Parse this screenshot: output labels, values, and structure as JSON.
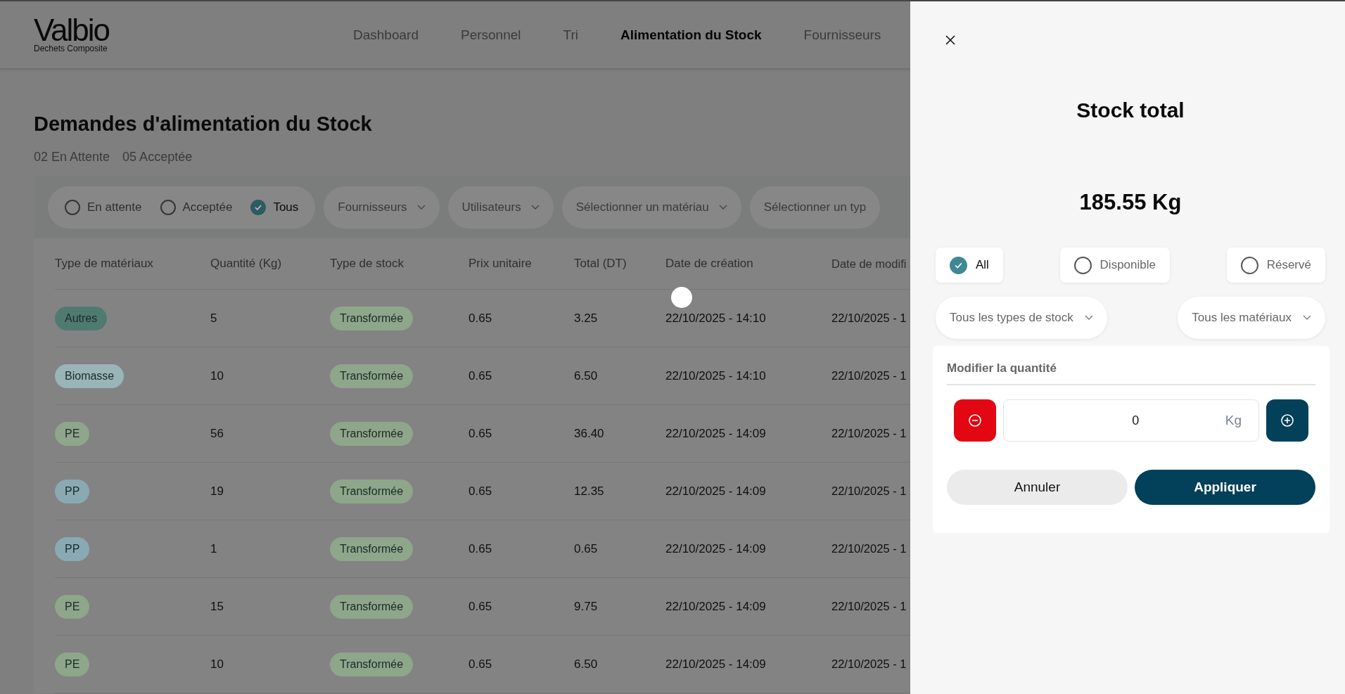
{
  "nav": {
    "logo": "Valbio",
    "logo_subtitle": "Dechets Composite",
    "items": [
      {
        "label": "Dashboard",
        "selected": false
      },
      {
        "label": "Personnel",
        "selected": false
      },
      {
        "label": "Tri",
        "selected": false
      },
      {
        "label": "Alimentation du Stock",
        "selected": true
      },
      {
        "label": "Fournisseurs",
        "selected": false
      }
    ]
  },
  "page": {
    "title": "Demandes d'alimentation du Stock",
    "counts": [
      "02 En Attente",
      "05 Acceptée"
    ]
  },
  "filters": {
    "status": [
      {
        "label": "En attente",
        "selected": false
      },
      {
        "label": "Acceptée",
        "selected": false
      },
      {
        "label": "Tous",
        "selected": true
      }
    ],
    "dropdowns": [
      {
        "label": "Fournisseurs",
        "chevron": true
      },
      {
        "label": "Utilisateurs",
        "chevron": true
      },
      {
        "label": "Sélectionner un matériau",
        "chevron": true
      },
      {
        "label": "Sélectionner un typ",
        "chevron": false
      }
    ]
  },
  "table": {
    "columns": [
      "Type de matériaux",
      "Quantité (Kg)",
      "Type de stock",
      "Prix unitaire",
      "Total (DT)",
      "Date de création",
      "Date de modifi"
    ],
    "rows": [
      {
        "material": "Autres",
        "color": "#4f7a70",
        "quantity": "5",
        "stock_type": "Transformée",
        "unit_price": "0.65",
        "total": "3.25",
        "created": "22/10/2025 - 14:10",
        "modified": "22/10/2025 - 1"
      },
      {
        "material": "Biomasse",
        "color": "#9ab4b8",
        "quantity": "10",
        "stock_type": "Transformée",
        "unit_price": "0.65",
        "total": "6.50",
        "created": "22/10/2025 - 14:10",
        "modified": "22/10/2025 - 1"
      },
      {
        "material": "PE",
        "color": "#8ea68a",
        "quantity": "56",
        "stock_type": "Transformée",
        "unit_price": "0.65",
        "total": "36.40",
        "created": "22/10/2025 - 14:09",
        "modified": "22/10/2025 - 1"
      },
      {
        "material": "PP",
        "color": "#89aab3",
        "quantity": "19",
        "stock_type": "Transformée",
        "unit_price": "0.65",
        "total": "12.35",
        "created": "22/10/2025 - 14:09",
        "modified": "22/10/2025 - 1"
      },
      {
        "material": "PP",
        "color": "#89aab3",
        "quantity": "1",
        "stock_type": "Transformée",
        "unit_price": "0.65",
        "total": "0.65",
        "created": "22/10/2025 - 14:09",
        "modified": "22/10/2025 - 1"
      },
      {
        "material": "PE",
        "color": "#8ea68a",
        "quantity": "15",
        "stock_type": "Transformée",
        "unit_price": "0.65",
        "total": "9.75",
        "created": "22/10/2025 - 14:09",
        "modified": "22/10/2025 - 1"
      },
      {
        "material": "PE",
        "color": "#8ea68a",
        "quantity": "10",
        "stock_type": "Transformée",
        "unit_price": "0.65",
        "total": "6.50",
        "created": "22/10/2025 - 14:09",
        "modified": "22/10/2025 - 1"
      }
    ]
  },
  "panel": {
    "title": "Stock total",
    "total": "185.55 Kg",
    "statuses": [
      {
        "label": "All",
        "selected": true
      },
      {
        "label": "Disponible",
        "selected": false
      },
      {
        "label": "Réservé",
        "selected": false
      }
    ],
    "dropdowns": [
      "Tous les types de stock",
      "Tous les matériaux"
    ],
    "quantity_card": {
      "title": "Modifier la quantité",
      "value": "0",
      "unit": "Kg"
    },
    "buttons": [
      {
        "label": "Annuler",
        "kind": "secondary"
      },
      {
        "label": "Appliquer",
        "kind": "primary"
      }
    ]
  }
}
